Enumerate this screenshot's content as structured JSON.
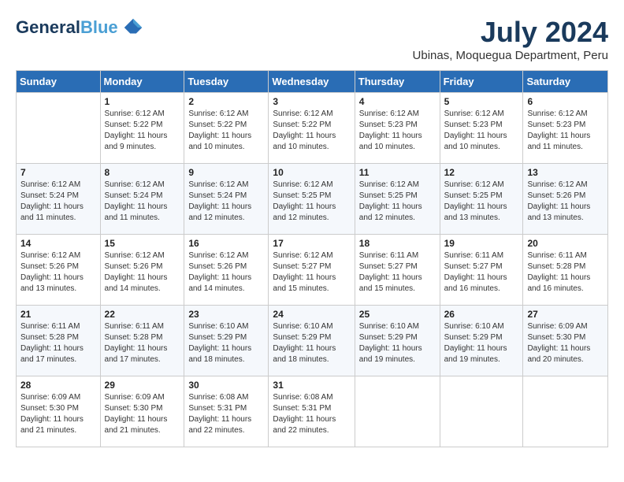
{
  "header": {
    "logo_line1": "General",
    "logo_line2": "Blue",
    "month_year": "July 2024",
    "location": "Ubinas, Moquegua Department, Peru"
  },
  "days_of_week": [
    "Sunday",
    "Monday",
    "Tuesday",
    "Wednesday",
    "Thursday",
    "Friday",
    "Saturday"
  ],
  "weeks": [
    [
      {
        "day": "",
        "info": ""
      },
      {
        "day": "1",
        "info": "Sunrise: 6:12 AM\nSunset: 5:22 PM\nDaylight: 11 hours\nand 9 minutes."
      },
      {
        "day": "2",
        "info": "Sunrise: 6:12 AM\nSunset: 5:22 PM\nDaylight: 11 hours\nand 10 minutes."
      },
      {
        "day": "3",
        "info": "Sunrise: 6:12 AM\nSunset: 5:22 PM\nDaylight: 11 hours\nand 10 minutes."
      },
      {
        "day": "4",
        "info": "Sunrise: 6:12 AM\nSunset: 5:23 PM\nDaylight: 11 hours\nand 10 minutes."
      },
      {
        "day": "5",
        "info": "Sunrise: 6:12 AM\nSunset: 5:23 PM\nDaylight: 11 hours\nand 10 minutes."
      },
      {
        "day": "6",
        "info": "Sunrise: 6:12 AM\nSunset: 5:23 PM\nDaylight: 11 hours\nand 11 minutes."
      }
    ],
    [
      {
        "day": "7",
        "info": "Sunrise: 6:12 AM\nSunset: 5:24 PM\nDaylight: 11 hours\nand 11 minutes."
      },
      {
        "day": "8",
        "info": "Sunrise: 6:12 AM\nSunset: 5:24 PM\nDaylight: 11 hours\nand 11 minutes."
      },
      {
        "day": "9",
        "info": "Sunrise: 6:12 AM\nSunset: 5:24 PM\nDaylight: 11 hours\nand 12 minutes."
      },
      {
        "day": "10",
        "info": "Sunrise: 6:12 AM\nSunset: 5:25 PM\nDaylight: 11 hours\nand 12 minutes."
      },
      {
        "day": "11",
        "info": "Sunrise: 6:12 AM\nSunset: 5:25 PM\nDaylight: 11 hours\nand 12 minutes."
      },
      {
        "day": "12",
        "info": "Sunrise: 6:12 AM\nSunset: 5:25 PM\nDaylight: 11 hours\nand 13 minutes."
      },
      {
        "day": "13",
        "info": "Sunrise: 6:12 AM\nSunset: 5:26 PM\nDaylight: 11 hours\nand 13 minutes."
      }
    ],
    [
      {
        "day": "14",
        "info": "Sunrise: 6:12 AM\nSunset: 5:26 PM\nDaylight: 11 hours\nand 13 minutes."
      },
      {
        "day": "15",
        "info": "Sunrise: 6:12 AM\nSunset: 5:26 PM\nDaylight: 11 hours\nand 14 minutes."
      },
      {
        "day": "16",
        "info": "Sunrise: 6:12 AM\nSunset: 5:26 PM\nDaylight: 11 hours\nand 14 minutes."
      },
      {
        "day": "17",
        "info": "Sunrise: 6:12 AM\nSunset: 5:27 PM\nDaylight: 11 hours\nand 15 minutes."
      },
      {
        "day": "18",
        "info": "Sunrise: 6:11 AM\nSunset: 5:27 PM\nDaylight: 11 hours\nand 15 minutes."
      },
      {
        "day": "19",
        "info": "Sunrise: 6:11 AM\nSunset: 5:27 PM\nDaylight: 11 hours\nand 16 minutes."
      },
      {
        "day": "20",
        "info": "Sunrise: 6:11 AM\nSunset: 5:28 PM\nDaylight: 11 hours\nand 16 minutes."
      }
    ],
    [
      {
        "day": "21",
        "info": "Sunrise: 6:11 AM\nSunset: 5:28 PM\nDaylight: 11 hours\nand 17 minutes."
      },
      {
        "day": "22",
        "info": "Sunrise: 6:11 AM\nSunset: 5:28 PM\nDaylight: 11 hours\nand 17 minutes."
      },
      {
        "day": "23",
        "info": "Sunrise: 6:10 AM\nSunset: 5:29 PM\nDaylight: 11 hours\nand 18 minutes."
      },
      {
        "day": "24",
        "info": "Sunrise: 6:10 AM\nSunset: 5:29 PM\nDaylight: 11 hours\nand 18 minutes."
      },
      {
        "day": "25",
        "info": "Sunrise: 6:10 AM\nSunset: 5:29 PM\nDaylight: 11 hours\nand 19 minutes."
      },
      {
        "day": "26",
        "info": "Sunrise: 6:10 AM\nSunset: 5:29 PM\nDaylight: 11 hours\nand 19 minutes."
      },
      {
        "day": "27",
        "info": "Sunrise: 6:09 AM\nSunset: 5:30 PM\nDaylight: 11 hours\nand 20 minutes."
      }
    ],
    [
      {
        "day": "28",
        "info": "Sunrise: 6:09 AM\nSunset: 5:30 PM\nDaylight: 11 hours\nand 21 minutes."
      },
      {
        "day": "29",
        "info": "Sunrise: 6:09 AM\nSunset: 5:30 PM\nDaylight: 11 hours\nand 21 minutes."
      },
      {
        "day": "30",
        "info": "Sunrise: 6:08 AM\nSunset: 5:31 PM\nDaylight: 11 hours\nand 22 minutes."
      },
      {
        "day": "31",
        "info": "Sunrise: 6:08 AM\nSunset: 5:31 PM\nDaylight: 11 hours\nand 22 minutes."
      },
      {
        "day": "",
        "info": ""
      },
      {
        "day": "",
        "info": ""
      },
      {
        "day": "",
        "info": ""
      }
    ]
  ]
}
